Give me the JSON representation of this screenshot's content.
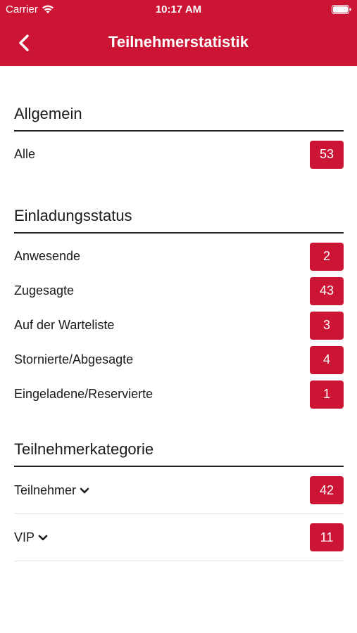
{
  "status_bar": {
    "carrier": "Carrier",
    "time": "10:17 AM"
  },
  "nav": {
    "title": "Teilnehmerstatistik"
  },
  "sections": {
    "general": {
      "title": "Allgemein",
      "rows": [
        {
          "label": "Alle",
          "count": "53"
        }
      ]
    },
    "invitation": {
      "title": "Einladungsstatus",
      "rows": [
        {
          "label": "Anwesende",
          "count": "2"
        },
        {
          "label": "Zugesagte",
          "count": "43"
        },
        {
          "label": "Auf der Warteliste",
          "count": "3"
        },
        {
          "label": "Stornierte/Abgesagte",
          "count": "4"
        },
        {
          "label": "Eingeladene/Reservierte",
          "count": "1"
        }
      ]
    },
    "category": {
      "title": "Teilnehmerkategorie",
      "rows": [
        {
          "label": "Teilnehmer",
          "count": "42"
        },
        {
          "label": "VIP",
          "count": "11"
        }
      ]
    }
  },
  "colors": {
    "brand": "#cc1535",
    "text": "#1a1a1a",
    "divider": "#e2e2e2"
  },
  "icons": {
    "back": "chevron-left-icon",
    "expand": "chevron-down-icon",
    "wifi": "wifi-icon",
    "battery": "battery-icon"
  }
}
